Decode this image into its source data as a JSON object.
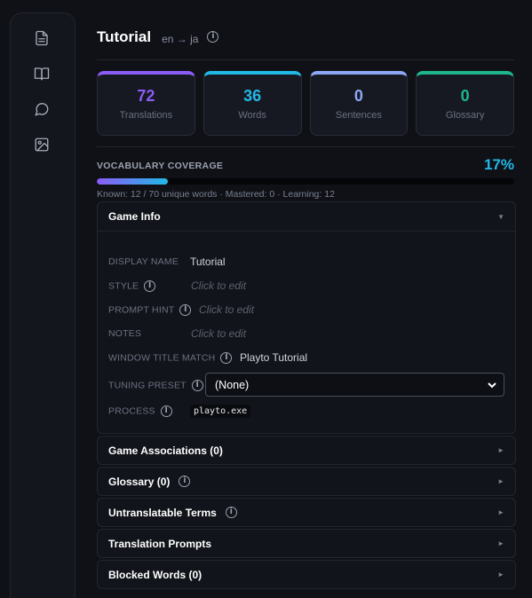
{
  "sidebar": {
    "icons": [
      "document-icon",
      "book-icon",
      "chat-icon",
      "image-icon"
    ]
  },
  "header": {
    "title": "Tutorial",
    "lang": "en → ja"
  },
  "stats": [
    {
      "value": "72",
      "label": "Translations",
      "color": "#8b5cf6"
    },
    {
      "value": "36",
      "label": "Words",
      "color": "#22b8e6"
    },
    {
      "value": "0",
      "label": "Sentences",
      "color": "#8fa8f5"
    },
    {
      "value": "0",
      "label": "Glossary",
      "color": "#1fb58b"
    }
  ],
  "coverage": {
    "label": "VOCABULARY COVERAGE",
    "percent_text": "17%",
    "percent": 17,
    "sub": "Known: 12 / 70 unique words · Mastered: 0 · Learning: 12"
  },
  "game_info": {
    "title": "Game Info",
    "display_name_label": "DISPLAY NAME",
    "display_name": "Tutorial",
    "style_label": "STYLE",
    "style_placeholder": "Click to edit",
    "prompt_hint_label": "PROMPT HINT",
    "prompt_hint_placeholder": "Click to edit",
    "notes_label": "NOTES",
    "notes_placeholder": "Click to edit",
    "window_title_label": "WINDOW TITLE MATCH",
    "window_title": "Playto Tutorial",
    "tuning_label": "TUNING PRESET",
    "tuning_value": "(None)",
    "process_label": "PROCESS",
    "process_value": "playto.exe"
  },
  "sections": [
    {
      "title": "Game Associations (0)",
      "info": false
    },
    {
      "title": "Glossary (0)",
      "info": true
    },
    {
      "title": "Untranslatable Terms",
      "info": true
    },
    {
      "title": "Translation Prompts",
      "info": false
    },
    {
      "title": "Blocked Words (0)",
      "info": false
    }
  ]
}
